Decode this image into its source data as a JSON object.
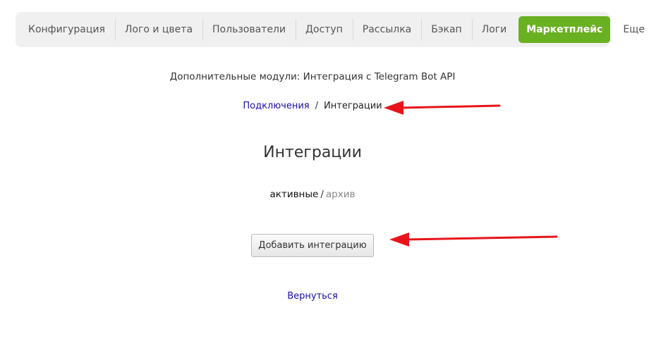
{
  "nav": {
    "tabs": [
      {
        "label": "Конфигурация"
      },
      {
        "label": "Лого и цвета"
      },
      {
        "label": "Пользователи"
      },
      {
        "label": "Доступ"
      },
      {
        "label": "Рассылка"
      },
      {
        "label": "Бэкап"
      },
      {
        "label": "Логи"
      },
      {
        "label": "Маркетплейс",
        "active": true
      },
      {
        "label": "Еще"
      }
    ]
  },
  "module_title": "Дополнительные модули: Интеграция с Telegram Bot API",
  "breadcrumb": {
    "parent": "Подключения",
    "separator": "/",
    "current": "Интеграции"
  },
  "page_title": "Интеграции",
  "filters": {
    "active": "активные",
    "separator": "/",
    "archive": "архив"
  },
  "add_button_label": "Добавить интеграцию",
  "back_link": "Вернуться",
  "colors": {
    "accent": "#6ab023",
    "link": "#1a0dab",
    "annotation_arrow": "#e8141b"
  }
}
